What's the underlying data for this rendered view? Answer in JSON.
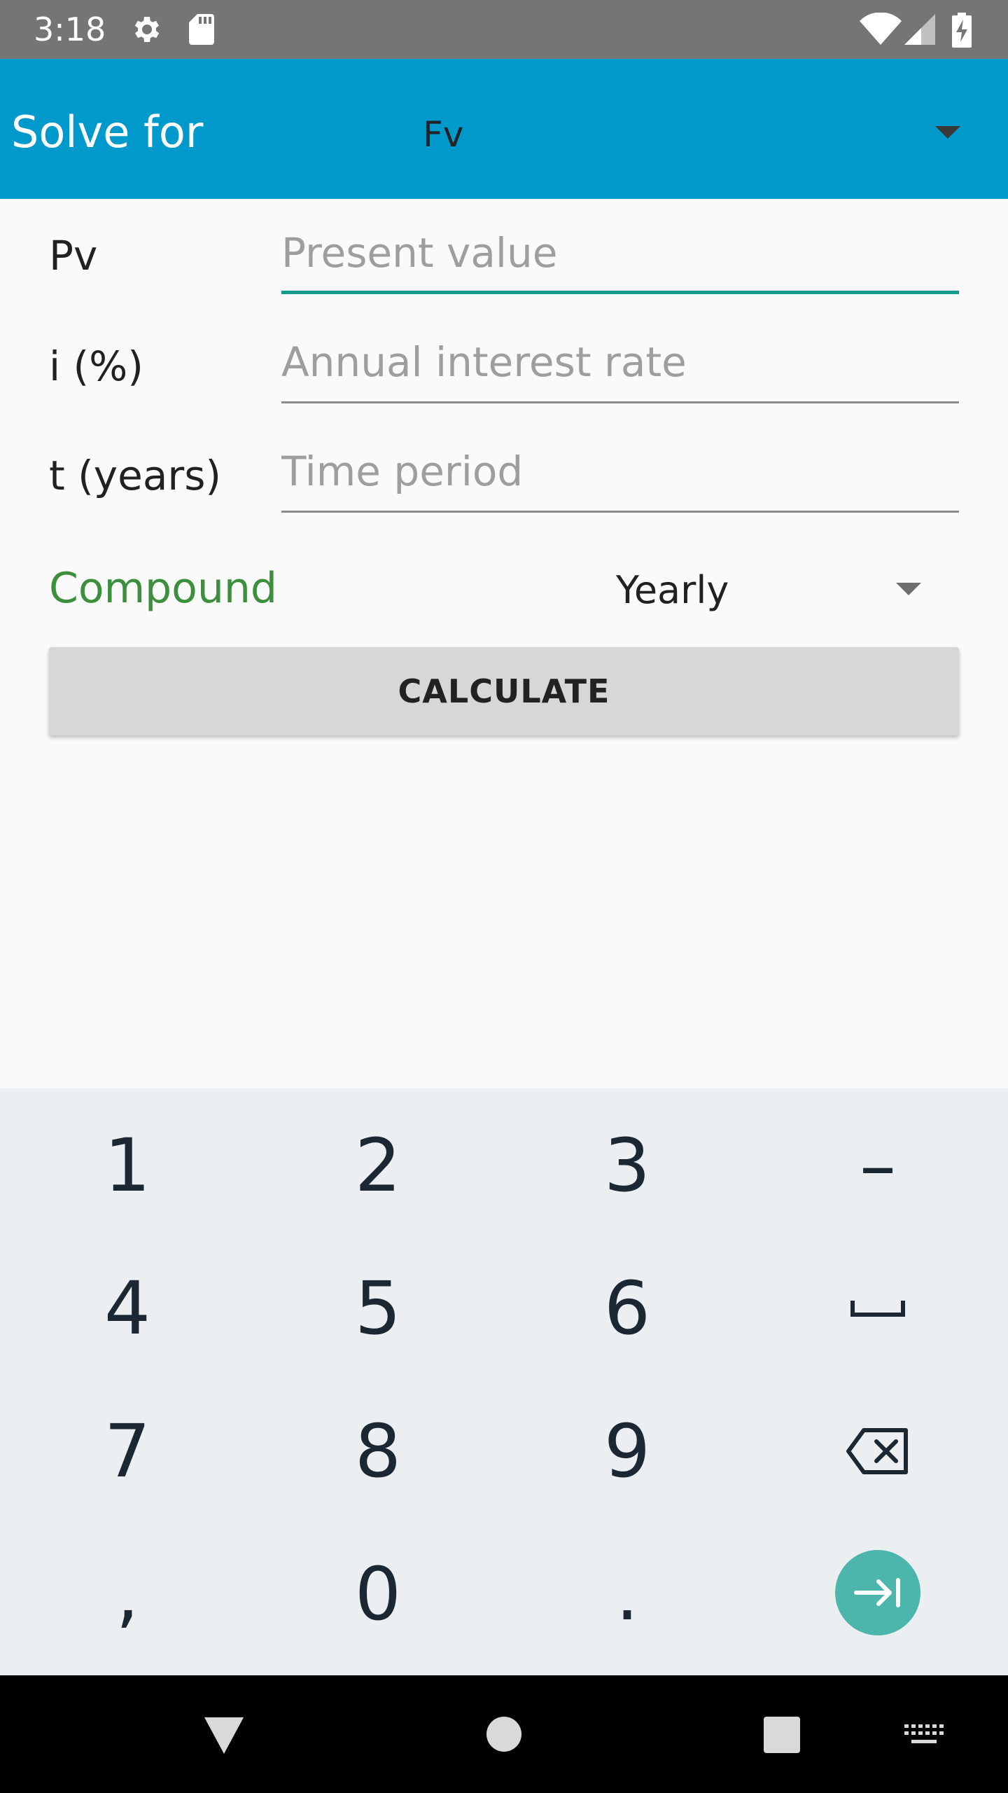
{
  "status_bar": {
    "time": "3:18",
    "icons": [
      "settings-icon",
      "sd-card-icon",
      "wifi-icon",
      "cell-signal-icon",
      "battery-charging-icon"
    ]
  },
  "toolbar": {
    "solve_for_label": "Solve for",
    "solve_for_value": "Fv",
    "color": "#0099cc"
  },
  "form": {
    "rows": [
      {
        "label": "Pv",
        "placeholder": "Present value",
        "value": ""
      },
      {
        "label": "i (%)",
        "placeholder": "Annual interest rate",
        "value": ""
      },
      {
        "label": "t (years)",
        "placeholder": "Time period",
        "value": ""
      }
    ],
    "compound_label": "Compound",
    "compound_value": "Yearly",
    "calculate_label": "CALCULATE",
    "active_color": "#139b8e",
    "compound_color": "#3c8f3c"
  },
  "keyboard": {
    "keys": [
      "1",
      "2",
      "3",
      "–",
      "4",
      "5",
      "6",
      "space-icon",
      "7",
      "8",
      "9",
      "backspace-icon",
      ",",
      "0",
      ".",
      "next-field-icon"
    ],
    "enter_color": "#4db6ac"
  },
  "nav_bar": {
    "icons": [
      "back-triangle-icon",
      "home-circle-icon",
      "recents-square-icon",
      "keyboard-switch-icon"
    ]
  }
}
